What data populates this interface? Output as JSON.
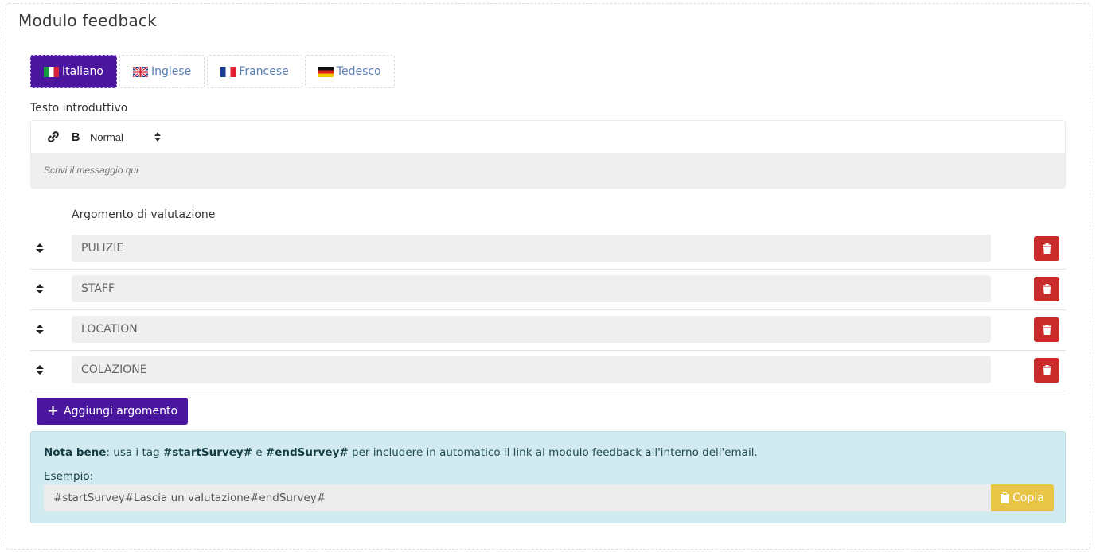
{
  "card": {
    "title": "Modulo feedback"
  },
  "tabs": [
    {
      "label": "Italiano",
      "flag": "italy-flag-icon",
      "active": true
    },
    {
      "label": "Inglese",
      "flag": "uk-flag-icon",
      "active": false
    },
    {
      "label": "Francese",
      "flag": "france-flag-icon",
      "active": false
    },
    {
      "label": "Tedesco",
      "flag": "germany-flag-icon",
      "active": false
    }
  ],
  "intro": {
    "label": "Testo introduttivo",
    "toolbar": {
      "link_icon": "link-icon",
      "bold_label": "B",
      "format_value": "Normal"
    },
    "placeholder": "Scrivi il messaggio qui"
  },
  "topics": {
    "label": "Argomento di valutazione",
    "items": [
      "PULIZIE",
      "STAFF",
      "LOCATION",
      "COLAZIONE"
    ],
    "add_label": "Aggiungi argomento"
  },
  "note": {
    "prefix": "Nota bene",
    "text_1": ": usa i tag ",
    "tag_start": "#startSurvey#",
    "text_2": " e ",
    "tag_end": "#endSurvey#",
    "text_3": " per includere in automatico il link al modulo feedback all'interno dell'email.",
    "example_label": "Esempio:",
    "example_value": "#startSurvey#Lascia un valutazione#endSurvey#",
    "copy_label": "Copia"
  },
  "colors": {
    "primary": "#4b169e",
    "danger": "#c92a2a",
    "warning": "#e8c547",
    "info_bg": "#d2ebf0"
  }
}
